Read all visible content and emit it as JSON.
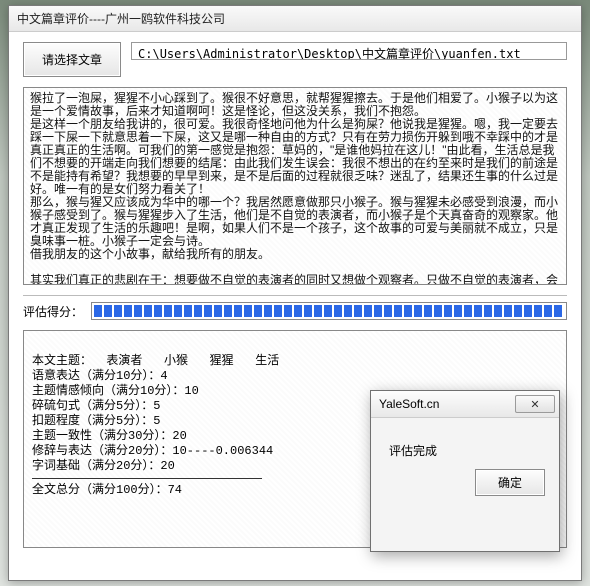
{
  "window": {
    "title": "中文篇章评价----广州一鸥软件科技公司"
  },
  "toolbar": {
    "choose_label": "请选择文章",
    "path": "C:\\Users\\Administrator\\Desktop\\中文篇章评价\\yuanfen.txt"
  },
  "article_text": "猴拉了一泡屎，猩猩不小心踩到了。猴很不好意思，就帮猩猩擦去。于是他们相爱了。小猴子以为这是一个爱情故事，后来才知道啊呵！这是怪论，但这没关系，我们不抱怨。\n是这样一个朋友给我讲的，很可爱。我很奇怪地问他为什么是狗屎？他说我是猩猩。嗯，我一定要去踩一下屎一下就意思着一下屎，这又是哪一种自由的方式？只有在劳力损伤开躲到哦不幸踩中的才是真正真正的生活啊。可我们的第一感觉是抱怨：草妈的，\"是谁他妈拉在这儿！\"由此看，生活总是我们不想要的开端走向我们想要的结尾：由此我们发生误会：我很不想出的在约至来时是我们的前途是不是能持有希望？我想要的早早到来，是不是后面的过程就很乏味？迷乱了，结果还生事的什么过是好。唯一有的是女们努力看关了！\n那么，猴与猩又应该成为华中的哪一个？我居然愿意做那只小猴子。猴与猩猩未必感受到浪漫，而小猴子感受到了。猴与猩猩步入了生活，他们是不自觉的表演者，而小猴子是个天真奋奇的观察家。他才真正发现了生活的乐趣吧！是啊，如果人们不是一个孩子，这个故事的可爱与美丽就不成立，只是臭味事一桩。小猴子一定会与诗。\n借我朋友的这个小故事，献给我所有的朋友。\n\n其实我们真正的悲剧在于：想要做不自觉的表演者的同时又想做个观察者。只做不自觉的表演者，会幸福，但不知道自己有多幸福。做观察者，则能意识到幸福。但同时成为这两者，又是绝不可能的。",
  "score": {
    "label": "评估得分：",
    "percent": 100
  },
  "results": {
    "topic_label": "本文主题：",
    "topics": [
      "表演者",
      "小猴",
      "猩猩",
      "生活"
    ],
    "lines": [
      "语意表达（满分10分）：4",
      "主题情感倾向（满分10分）：10",
      "碎硫句式（满分5分）：5",
      "扣题程度（满分5分）：5",
      "主题一致性（满分30分）：20",
      "修辞与表达（满分20分）：10----0.006344",
      "字词基础（满分20分）：20"
    ],
    "total_line": "全文总分（满分100分）：74"
  },
  "dialog": {
    "title": "YaleSoft.cn",
    "message": "评估完成",
    "ok_label": "确定",
    "close_glyph": "✕"
  }
}
